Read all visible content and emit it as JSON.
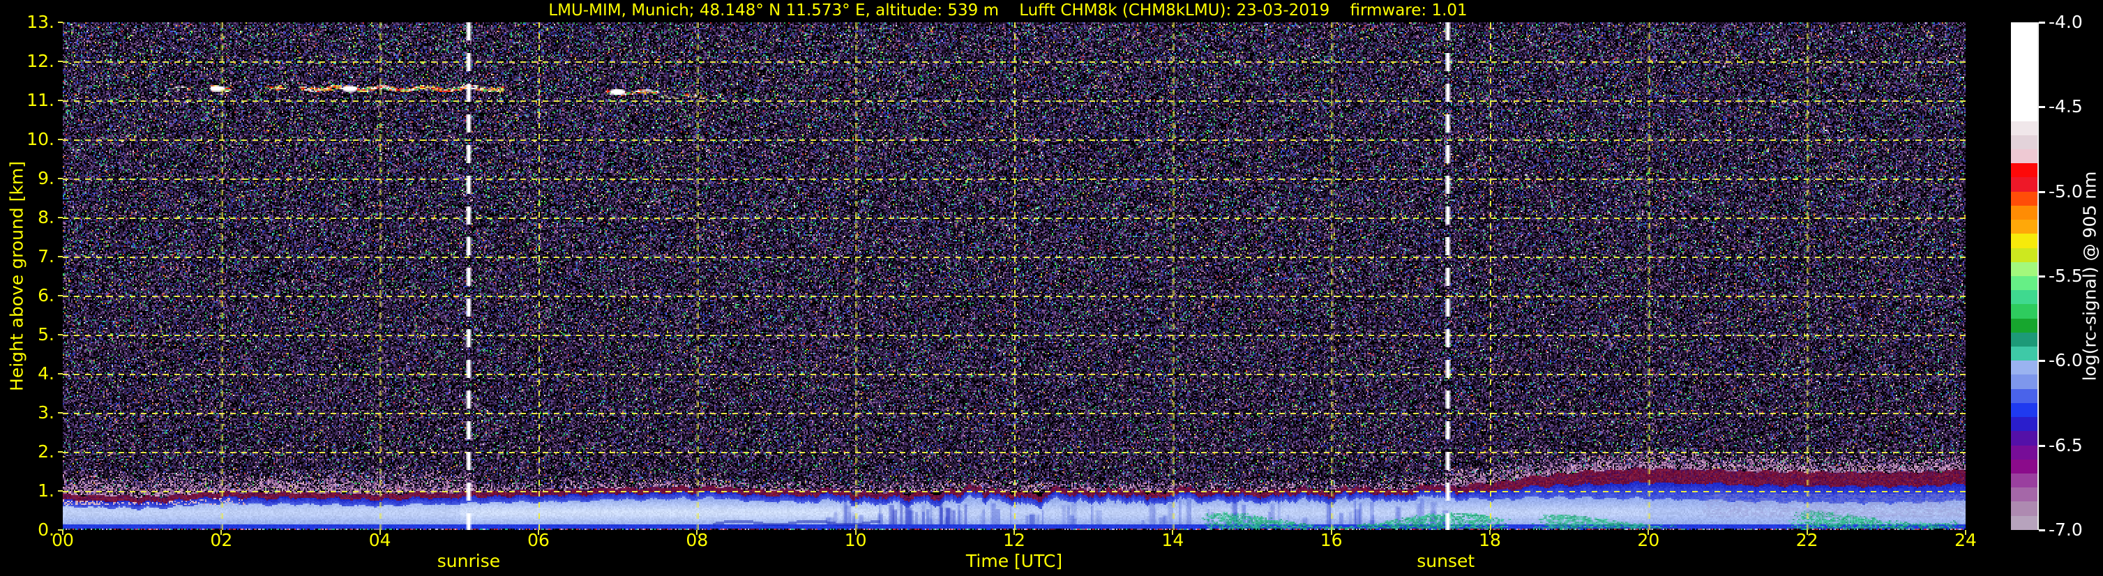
{
  "title": "LMU-MIM, Munich; 48.148° N 11.573° E, altitude: 539 m    Lufft CHM8k (CHM8kLMU): 23-03-2019    firmware: 1.01",
  "axes": {
    "y_label": "Height above ground [km]",
    "y_tick_labels": [
      "13.",
      "12.",
      "11.",
      "10.",
      "9.",
      "8.",
      "7.",
      "6.",
      "5.",
      "4.",
      "3.",
      "2.",
      "1.",
      "0."
    ],
    "x_label": "Time [UTC]",
    "x_tick_labels": [
      "00",
      "02",
      "04",
      "06",
      "08",
      "10",
      "12",
      "14",
      "16",
      "18",
      "20",
      "22",
      "24"
    ],
    "sunrise_label": "sunrise",
    "sunset_label": "sunset"
  },
  "colorbar": {
    "label": "log(rc-signal) @ 905 nm",
    "tick_labels": [
      "-4.0",
      "-4.5",
      "-5.0",
      "-5.5",
      "-6.0",
      "-6.5",
      "-7.0"
    ],
    "segments": [
      "#ffffff",
      "#ffffff",
      "#ffffff",
      "#ffffff",
      "#ffffff",
      "#ffffff",
      "#ffffff",
      "#f0e7ea",
      "#e3d3da",
      "#eec9d3",
      "#fd0909",
      "#ee1828",
      "#ff4d08",
      "#ff8c04",
      "#ffa809",
      "#f6ea0b",
      "#cde81f",
      "#a3f87c",
      "#66ef86",
      "#3fd98f",
      "#2ecc5e",
      "#17a62e",
      "#1d9a78",
      "#3ec9a7",
      "#9ab3f0",
      "#7e97ec",
      "#4a63ea",
      "#1f3af0",
      "#2a1ecc",
      "#5410a8",
      "#770d98",
      "#8b0b8b",
      "#9a3f9f",
      "#a567a8",
      "#ae8ab1",
      "#b7a3bd"
    ]
  },
  "colors": {
    "axis_text": "#ffff00",
    "colorbar_text": "#ffffff",
    "grid": "#ebeb46",
    "sun_line": "#ffffff",
    "background": "#000000",
    "bl_light": "#8ea6ec",
    "bl_core": "#d2e0fa",
    "bl_blue": "#4a5fe2",
    "bl_deep": "#1d28cc",
    "bl_cap": "#6e1240",
    "bl_cap2": "#55105a",
    "bl_green": "#2ec98e",
    "surface_blue": "#2741e8"
  },
  "chart_data": {
    "type": "heatmap",
    "title": "LMU-MIM, Munich; 48.148° N 11.573° E, altitude: 539 m  Lufft CHM8k (CHM8kLMU): 23-03-2019  firmware: 1.01",
    "x": {
      "label": "Time [UTC]",
      "range": [
        0,
        24
      ],
      "tick_interval_h": 2
    },
    "y": {
      "label": "Height above ground [km]",
      "range": [
        0,
        13
      ],
      "tick_interval_km": 1
    },
    "z": {
      "label": "log(rc-signal) @ 905 nm",
      "range": [
        -7.0,
        -4.0
      ],
      "tick_interval": 0.5
    },
    "sunrise": {
      "label": "sunrise",
      "time_utc_h": 5.12
    },
    "sunset": {
      "label": "sunset",
      "time_utc_h": 17.47
    },
    "boundary_layer_top_km": {
      "hours": [
        0,
        1,
        2,
        3,
        4,
        5,
        6,
        7,
        8,
        9,
        10,
        11,
        12,
        13,
        14,
        15,
        16,
        17,
        18,
        19,
        20,
        21,
        22,
        23,
        24
      ],
      "values": [
        0.9,
        0.82,
        0.95,
        0.93,
        0.9,
        0.95,
        1.0,
        1.05,
        1.08,
        1.0,
        0.95,
        1.0,
        1.0,
        1.0,
        1.0,
        1.0,
        1.02,
        1.05,
        1.2,
        1.45,
        1.55,
        1.5,
        1.45,
        1.45,
        1.5
      ]
    },
    "strong_near_surface_backscatter_km": [
      {
        "t0": 14.3,
        "t1": 18.3,
        "bot": 0.07,
        "top": 0.45
      },
      {
        "t0": 18.5,
        "t1": 20.4,
        "bot": 0.1,
        "top": 0.4
      },
      {
        "t0": 21.7,
        "t1": 24.0,
        "bot": 0.15,
        "top": 0.5
      }
    ],
    "cirrus_cloud_streaks_km": [
      {
        "t0": 1.38,
        "t1": 1.65,
        "km": 11.33,
        "intensity": "faint"
      },
      {
        "t0": 1.85,
        "t1": 2.12,
        "km": 11.3,
        "intensity": "bright"
      },
      {
        "t0": 2.52,
        "t1": 2.85,
        "km": 11.35,
        "intensity": "medium"
      },
      {
        "t0": 3.0,
        "t1": 5.55,
        "km": 11.3,
        "intensity": "bright"
      },
      {
        "t0": 6.85,
        "t1": 7.5,
        "km": 11.2,
        "intensity": "medium"
      },
      {
        "t0": 7.5,
        "t1": 8.1,
        "km": 11.1,
        "intensity": "faint"
      }
    ],
    "cirrus_bright_cores": [
      {
        "t": 1.95,
        "km": 11.3
      },
      {
        "t": 3.62,
        "km": 11.3
      },
      {
        "t": 7.0,
        "km": 11.22
      }
    ],
    "noise": "random speckle noise above the boundary layer, density and brightness increasing with height; mauve haze above BL top before sunrise and after sunset"
  }
}
